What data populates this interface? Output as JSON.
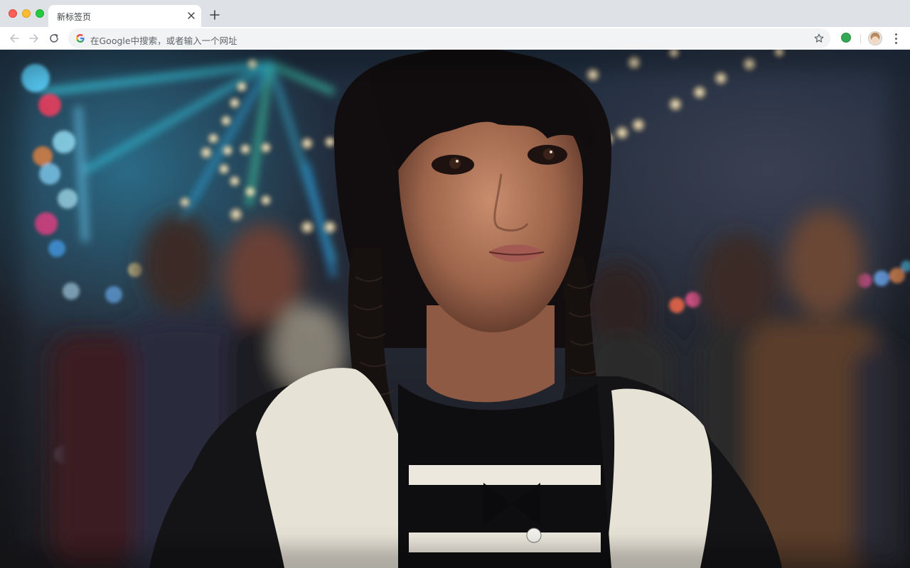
{
  "browser": {
    "tab": {
      "title": "新标签页"
    },
    "omnibox": {
      "placeholder": "在Google中搜索，或者输入一个网址"
    },
    "icons": {
      "back": "arrow-left-icon",
      "forward": "arrow-right-icon",
      "reload": "reload-icon",
      "google": "google-g-icon",
      "bookmark": "star-icon",
      "extension": "green-circle-extension-icon",
      "profile": "avatar",
      "menu": "three-dots-vertical-icon",
      "new_tab": "plus-icon",
      "close_tab": "close-icon"
    }
  },
  "wallpaper": {
    "subject": "girl with black braided pigtails, white hooded jacket, at a night carnival with ferris wheel lights"
  },
  "colors": {
    "tabstrip_bg": "#dee1e6",
    "toolbar_bg": "#ffffff",
    "omnibox_bg": "#f1f3f4",
    "traffic_close": "#ff5f57",
    "traffic_min": "#febc2e",
    "traffic_max": "#28c840",
    "extension_green": "#34a853"
  }
}
